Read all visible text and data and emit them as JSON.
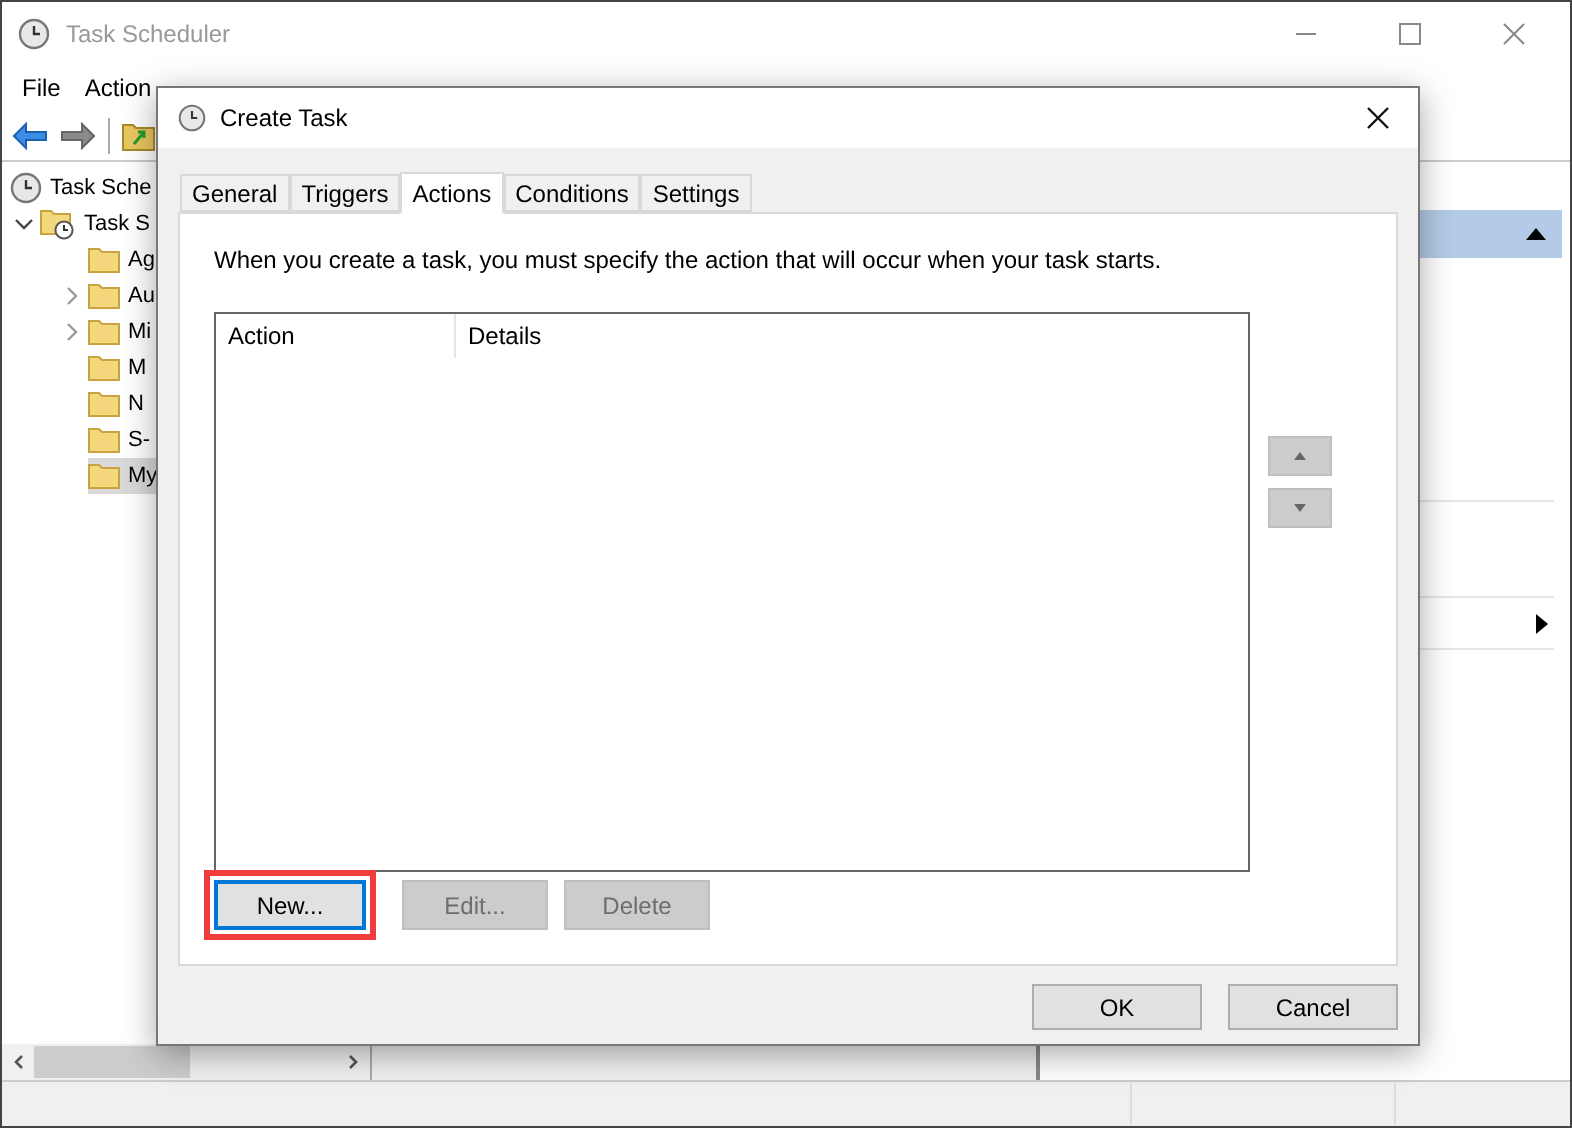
{
  "window": {
    "title": "Task Scheduler"
  },
  "menu": [
    "File",
    "Action"
  ],
  "tree": [
    {
      "label": "Task Sche",
      "selected": false,
      "children": [
        {
          "label": "Task S",
          "expanded": true,
          "selected": false,
          "children": [
            {
              "label": "Ag",
              "selected": false
            },
            {
              "label": "Au",
              "expanded": false,
              "selected": false
            },
            {
              "label": "Mi",
              "expanded": false,
              "selected": false
            },
            {
              "label": "M",
              "selected": false
            },
            {
              "label": "N",
              "selected": false
            },
            {
              "label": "S-",
              "selected": false
            },
            {
              "label": "My",
              "selected": true
            }
          ]
        }
      ]
    }
  ],
  "dialog": {
    "title": "Create Task",
    "tabs": [
      {
        "label": "General",
        "selected": false
      },
      {
        "label": "Triggers",
        "selected": false
      },
      {
        "label": "Actions",
        "selected": true
      },
      {
        "label": "Conditions",
        "selected": false
      },
      {
        "label": "Settings",
        "selected": false
      }
    ],
    "description": "When you create a task, you must specify the action that will occur when your task starts.",
    "list": {
      "columns": [
        "Action",
        "Details"
      ]
    },
    "buttons": [
      {
        "label": "New...",
        "disabled": false,
        "focused": true,
        "highlighted": true
      },
      {
        "label": "Edit...",
        "disabled": true,
        "focused": false,
        "highlighted": false
      },
      {
        "label": "Delete",
        "disabled": true,
        "focused": false,
        "highlighted": false
      }
    ],
    "footer": [
      "OK",
      "Cancel"
    ]
  }
}
